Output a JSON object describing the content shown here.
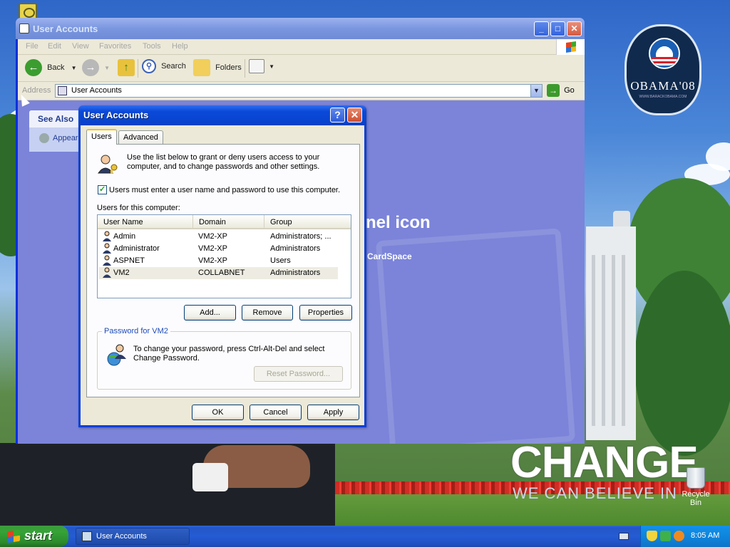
{
  "explorer": {
    "title": "User Accounts",
    "menu": [
      "File",
      "Edit",
      "View",
      "Favorites",
      "Tools",
      "Help"
    ],
    "toolbar": {
      "back_label": "Back",
      "search_label": "Search",
      "folders_label": "Folders"
    },
    "address": {
      "label": "Address",
      "value": "User Accounts",
      "go_label": "Go"
    },
    "see_also": {
      "title": "See Also",
      "item": "Appear"
    },
    "content": {
      "pick_text": "nel icon",
      "sub_text": "CardSpace"
    }
  },
  "dialog": {
    "title": "User Accounts",
    "tabs": [
      "Users",
      "Advanced"
    ],
    "intro_text": "Use the list below to grant or deny users access to your computer, and to change passwords and other settings.",
    "checkbox_label": "Users must enter a user name and password to use this computer.",
    "checkbox_checked": true,
    "users_label": "Users for this computer:",
    "columns": [
      "User Name",
      "Domain",
      "Group"
    ],
    "users": [
      {
        "name": "Admin",
        "domain": "VM2-XP",
        "group": "Administrators; ..."
      },
      {
        "name": "Administrator",
        "domain": "VM2-XP",
        "group": "Administrators"
      },
      {
        "name": "ASPNET",
        "domain": "VM2-XP",
        "group": "Users"
      },
      {
        "name": "VM2",
        "domain": "COLLABNET",
        "group": "Administrators"
      }
    ],
    "selected_user_index": 3,
    "buttons": {
      "add": "Add...",
      "remove": "Remove",
      "properties": "Properties",
      "reset_password": "Reset Password...",
      "ok": "OK",
      "cancel": "Cancel",
      "apply": "Apply"
    },
    "password_group": {
      "legend": "Password for VM2",
      "text": "To change your password, press Ctrl-Alt-Del and select Change Password."
    }
  },
  "desktop": {
    "logo_text": "OBAMA'08",
    "logo_sub": "WWW.BARACKOBAMA.COM",
    "slogan_title": "CHANGE",
    "slogan_sub": "WE CAN BELIEVE IN",
    "recycle_bin_label": "Recycle Bin"
  },
  "taskbar": {
    "start_label": "start",
    "task_label": "User Accounts",
    "clock": "8:05 AM"
  },
  "colors": {
    "xp_blue": "#0b49d8",
    "start_green": "#35a335",
    "explorer_bg": "#7b84d9"
  }
}
